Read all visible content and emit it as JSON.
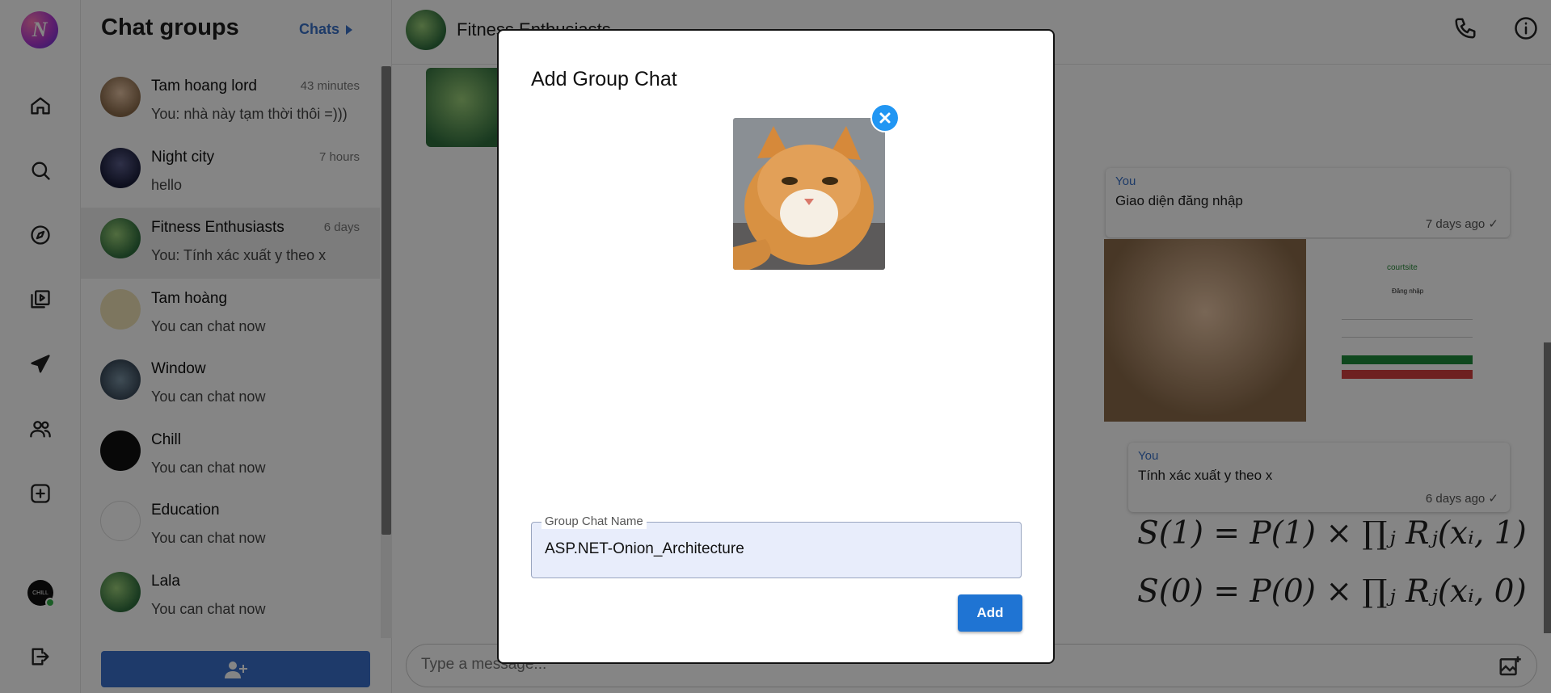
{
  "app": {
    "logo_letter": "N",
    "accent": "#3a6fcb"
  },
  "rail": {
    "nav": [
      "home-icon",
      "search-icon",
      "compass-icon",
      "video-library-icon",
      "send-icon",
      "people-icon",
      "add-box-icon",
      "logout-icon"
    ],
    "me_label": "CHILL"
  },
  "sidebar": {
    "title": "Chat groups",
    "chats_link": "Chats",
    "items": [
      {
        "name": "Tam hoang lord",
        "preview": "You: nhà này tạm thời thôi =)))",
        "time": "43 minutes",
        "avatar": "person",
        "active": false
      },
      {
        "name": "Night city",
        "preview": "hello",
        "time": "7 hours",
        "avatar": "dark",
        "active": false
      },
      {
        "name": "Fitness Enthusiasts",
        "preview": "You: Tính xác xuất y theo x",
        "time": "6 days",
        "avatar": "green",
        "active": true
      },
      {
        "name": "Tam hoàng",
        "preview": "You can chat now",
        "time": "",
        "avatar": "tan",
        "active": false
      },
      {
        "name": "Window",
        "preview": "You can chat now",
        "time": "",
        "avatar": "gray",
        "active": false
      },
      {
        "name": "Chill",
        "preview": "You can chat now",
        "time": "",
        "avatar": "black",
        "active": false
      },
      {
        "name": "Education",
        "preview": "You can chat now",
        "time": "",
        "avatar": "white",
        "active": false
      },
      {
        "name": "Lala",
        "preview": "You can chat now",
        "time": "",
        "avatar": "green",
        "active": false
      }
    ]
  },
  "conversation": {
    "title": "Fitness Enthusiasts",
    "messages": [
      {
        "sender": "You",
        "text": "Giao diện đăng nhập",
        "time": "7 days ago ✓"
      },
      {
        "sender": "You",
        "text": "Tính xác xuất y theo x",
        "time": "6 days ago ✓"
      }
    ],
    "login_shot": {
      "brand": "courtsite",
      "heading": "Đăng nhập"
    },
    "formulas": [
      "S(1) = P(1) × ∏ⱼ Rⱼ(xᵢ, 1)",
      "S(0) = P(0) × ∏ⱼ Rⱼ(xᵢ, 0)"
    ],
    "composer_placeholder": "Type a message..."
  },
  "modal": {
    "title": "Add Group Chat",
    "field_label": "Group Chat Name",
    "field_value": "ASP.NET-Onion_Architecture",
    "add_label": "Add"
  }
}
